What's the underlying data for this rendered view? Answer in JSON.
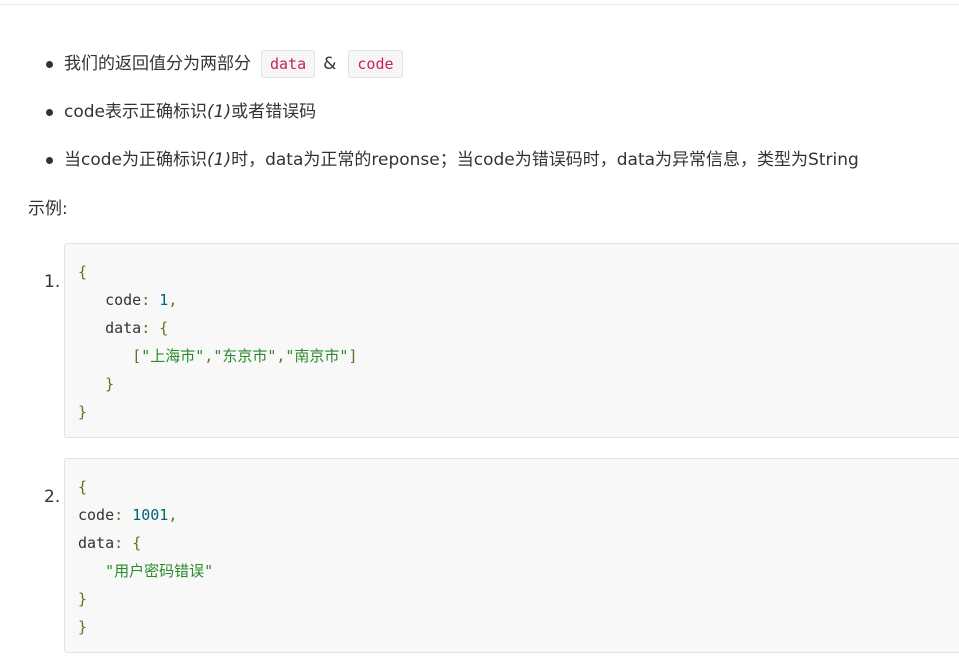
{
  "bullets": [
    {
      "text": "我们的返回值分为两部分",
      "chip1": "data",
      "amp": "&",
      "chip2": "code"
    },
    {
      "prefix": "code表示正确标识",
      "italic": "(1)",
      "suffix": "或者错误码"
    },
    {
      "prefix": "当code为正确标识",
      "italic": "(1)",
      "suffix": "时，data为正常的reponse；当code为错误码时，data为异常信息，类型为String"
    }
  ],
  "example_label": "示例:",
  "examples": [
    {
      "number": "1.",
      "lines": {
        "l1": "{",
        "l2_key": "code",
        "l2_colon": ": ",
        "l2_value": "1",
        "l2_comma": ",",
        "l3_key": "data",
        "l3_colon": ": ",
        "l3_brace": "{",
        "l4_open": "[",
        "l4_s1": "\"上海市\"",
        "l4_c1": ",",
        "l4_s2": "\"东京市\"",
        "l4_c2": ",",
        "l4_s3": "\"南京市\"",
        "l4_close": "]",
        "l5": "}",
        "l6": "}"
      }
    },
    {
      "number": "2.",
      "lines": {
        "l1": "{",
        "l2_key": "code",
        "l2_colon": ": ",
        "l2_value": "1001",
        "l2_comma": ",",
        "l3_key": "data",
        "l3_colon": ": ",
        "l3_brace": "{",
        "l4_str": "\"用户密码错误\"",
        "l5": "}",
        "l6": "}"
      }
    }
  ]
}
